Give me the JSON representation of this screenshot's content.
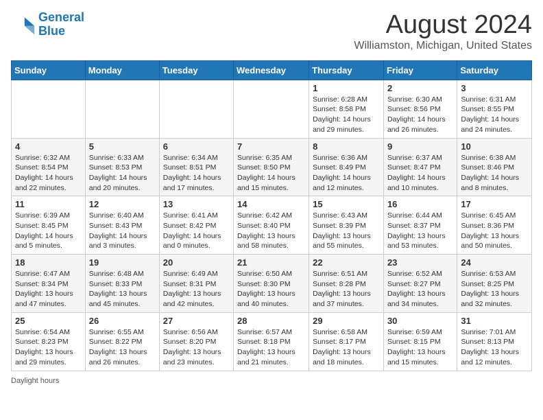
{
  "header": {
    "logo_line1": "General",
    "logo_line2": "Blue",
    "title": "August 2024",
    "subtitle": "Williamston, Michigan, United States"
  },
  "weekdays": [
    "Sunday",
    "Monday",
    "Tuesday",
    "Wednesday",
    "Thursday",
    "Friday",
    "Saturday"
  ],
  "weeks": [
    [
      {
        "day": "",
        "info": ""
      },
      {
        "day": "",
        "info": ""
      },
      {
        "day": "",
        "info": ""
      },
      {
        "day": "",
        "info": ""
      },
      {
        "day": "1",
        "info": "Sunrise: 6:28 AM\nSunset: 8:58 PM\nDaylight: 14 hours\nand 29 minutes."
      },
      {
        "day": "2",
        "info": "Sunrise: 6:30 AM\nSunset: 8:56 PM\nDaylight: 14 hours\nand 26 minutes."
      },
      {
        "day": "3",
        "info": "Sunrise: 6:31 AM\nSunset: 8:55 PM\nDaylight: 14 hours\nand 24 minutes."
      }
    ],
    [
      {
        "day": "4",
        "info": "Sunrise: 6:32 AM\nSunset: 8:54 PM\nDaylight: 14 hours\nand 22 minutes."
      },
      {
        "day": "5",
        "info": "Sunrise: 6:33 AM\nSunset: 8:53 PM\nDaylight: 14 hours\nand 20 minutes."
      },
      {
        "day": "6",
        "info": "Sunrise: 6:34 AM\nSunset: 8:51 PM\nDaylight: 14 hours\nand 17 minutes."
      },
      {
        "day": "7",
        "info": "Sunrise: 6:35 AM\nSunset: 8:50 PM\nDaylight: 14 hours\nand 15 minutes."
      },
      {
        "day": "8",
        "info": "Sunrise: 6:36 AM\nSunset: 8:49 PM\nDaylight: 14 hours\nand 12 minutes."
      },
      {
        "day": "9",
        "info": "Sunrise: 6:37 AM\nSunset: 8:47 PM\nDaylight: 14 hours\nand 10 minutes."
      },
      {
        "day": "10",
        "info": "Sunrise: 6:38 AM\nSunset: 8:46 PM\nDaylight: 14 hours\nand 8 minutes."
      }
    ],
    [
      {
        "day": "11",
        "info": "Sunrise: 6:39 AM\nSunset: 8:45 PM\nDaylight: 14 hours\nand 5 minutes."
      },
      {
        "day": "12",
        "info": "Sunrise: 6:40 AM\nSunset: 8:43 PM\nDaylight: 14 hours\nand 3 minutes."
      },
      {
        "day": "13",
        "info": "Sunrise: 6:41 AM\nSunset: 8:42 PM\nDaylight: 14 hours\nand 0 minutes."
      },
      {
        "day": "14",
        "info": "Sunrise: 6:42 AM\nSunset: 8:40 PM\nDaylight: 13 hours\nand 58 minutes."
      },
      {
        "day": "15",
        "info": "Sunrise: 6:43 AM\nSunset: 8:39 PM\nDaylight: 13 hours\nand 55 minutes."
      },
      {
        "day": "16",
        "info": "Sunrise: 6:44 AM\nSunset: 8:37 PM\nDaylight: 13 hours\nand 53 minutes."
      },
      {
        "day": "17",
        "info": "Sunrise: 6:45 AM\nSunset: 8:36 PM\nDaylight: 13 hours\nand 50 minutes."
      }
    ],
    [
      {
        "day": "18",
        "info": "Sunrise: 6:47 AM\nSunset: 8:34 PM\nDaylight: 13 hours\nand 47 minutes."
      },
      {
        "day": "19",
        "info": "Sunrise: 6:48 AM\nSunset: 8:33 PM\nDaylight: 13 hours\nand 45 minutes."
      },
      {
        "day": "20",
        "info": "Sunrise: 6:49 AM\nSunset: 8:31 PM\nDaylight: 13 hours\nand 42 minutes."
      },
      {
        "day": "21",
        "info": "Sunrise: 6:50 AM\nSunset: 8:30 PM\nDaylight: 13 hours\nand 40 minutes."
      },
      {
        "day": "22",
        "info": "Sunrise: 6:51 AM\nSunset: 8:28 PM\nDaylight: 13 hours\nand 37 minutes."
      },
      {
        "day": "23",
        "info": "Sunrise: 6:52 AM\nSunset: 8:27 PM\nDaylight: 13 hours\nand 34 minutes."
      },
      {
        "day": "24",
        "info": "Sunrise: 6:53 AM\nSunset: 8:25 PM\nDaylight: 13 hours\nand 32 minutes."
      }
    ],
    [
      {
        "day": "25",
        "info": "Sunrise: 6:54 AM\nSunset: 8:23 PM\nDaylight: 13 hours\nand 29 minutes."
      },
      {
        "day": "26",
        "info": "Sunrise: 6:55 AM\nSunset: 8:22 PM\nDaylight: 13 hours\nand 26 minutes."
      },
      {
        "day": "27",
        "info": "Sunrise: 6:56 AM\nSunset: 8:20 PM\nDaylight: 13 hours\nand 23 minutes."
      },
      {
        "day": "28",
        "info": "Sunrise: 6:57 AM\nSunset: 8:18 PM\nDaylight: 13 hours\nand 21 minutes."
      },
      {
        "day": "29",
        "info": "Sunrise: 6:58 AM\nSunset: 8:17 PM\nDaylight: 13 hours\nand 18 minutes."
      },
      {
        "day": "30",
        "info": "Sunrise: 6:59 AM\nSunset: 8:15 PM\nDaylight: 13 hours\nand 15 minutes."
      },
      {
        "day": "31",
        "info": "Sunrise: 7:01 AM\nSunset: 8:13 PM\nDaylight: 13 hours\nand 12 minutes."
      }
    ]
  ],
  "footer": "Daylight hours"
}
